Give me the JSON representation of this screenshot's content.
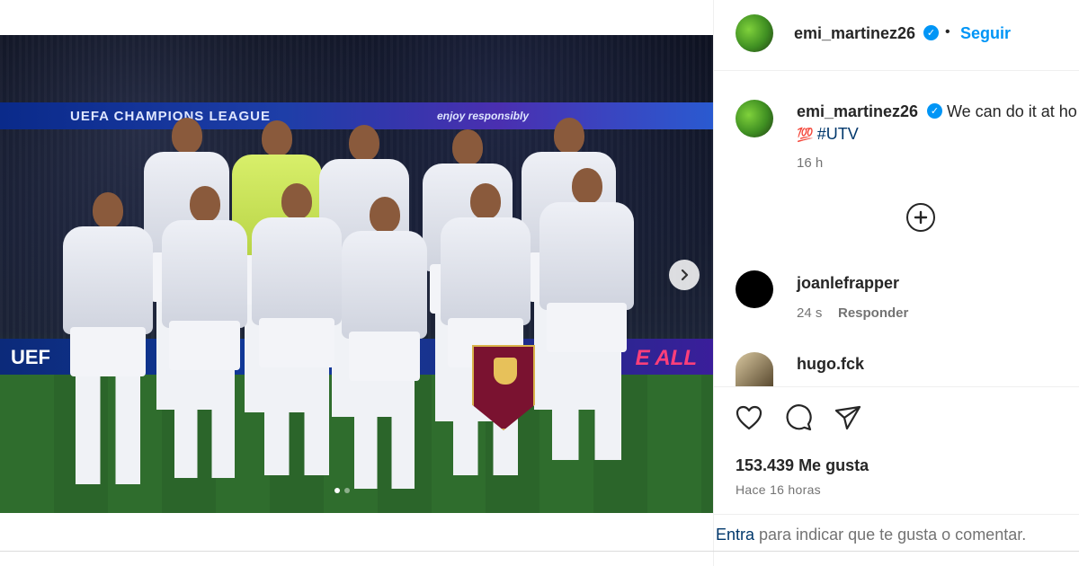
{
  "post": {
    "author": "emi_martinez26",
    "follow_label": "Seguir",
    "separator": "•",
    "verified_mark": "✓"
  },
  "photo": {
    "banner_text": "UEFA CHAMPIONS LEAGUE",
    "banner_sub": "enjoy responsibly",
    "board_left": "UEF",
    "board_right": "E ALL",
    "next_icon": "chevron-right-icon",
    "carousel_index": 1,
    "carousel_total": 2
  },
  "caption": {
    "username": "emi_martinez26",
    "text": "We can do it at ho",
    "emoji": "💯",
    "hashtag": "#UTV",
    "time": "16 h"
  },
  "load_more_icon": "plus-circle-icon",
  "comments": [
    {
      "username": "joanlefrapper",
      "time": "24 s",
      "reply_label": "Responder"
    },
    {
      "username": "hugo.fck"
    }
  ],
  "actions": {
    "like_icon": "heart-icon",
    "comment_icon": "comment-icon",
    "share_icon": "send-icon"
  },
  "likes_text": "153.439 Me gusta",
  "posted_ago": "Hace 16 horas",
  "footer": {
    "link": "Entra",
    "text": " para indicar que te gusta o comentar."
  }
}
